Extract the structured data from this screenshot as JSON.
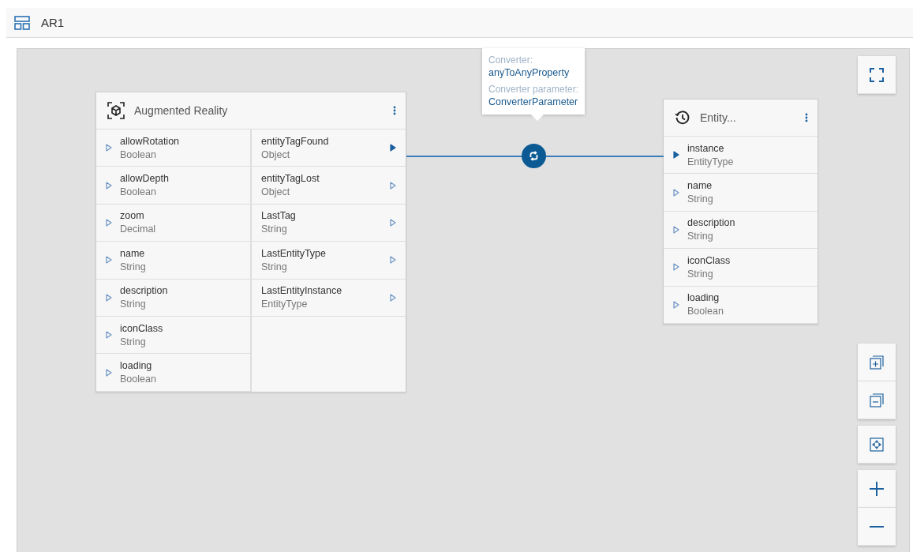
{
  "header": {
    "title": "AR1"
  },
  "nodes": [
    {
      "kind": "ar",
      "title": "Augmented Reality",
      "inputs": [
        {
          "name": "allowRotation",
          "type": "Boolean",
          "connected": false
        },
        {
          "name": "allowDepth",
          "type": "Boolean",
          "connected": false
        },
        {
          "name": "zoom",
          "type": "Decimal",
          "connected": false
        },
        {
          "name": "name",
          "type": "String",
          "connected": false
        },
        {
          "name": "description",
          "type": "String",
          "connected": false
        },
        {
          "name": "iconClass",
          "type": "String",
          "connected": false
        },
        {
          "name": "loading",
          "type": "Boolean",
          "connected": false
        }
      ],
      "outputs": [
        {
          "name": "entityTagFound",
          "type": "Object",
          "connected": true
        },
        {
          "name": "entityTagLost",
          "type": "Object",
          "connected": false
        },
        {
          "name": "LastTag",
          "type": "String",
          "connected": false
        },
        {
          "name": "LastEntityType",
          "type": "String",
          "connected": false
        },
        {
          "name": "LastEntityInstance",
          "type": "EntityType",
          "connected": false
        }
      ]
    },
    {
      "kind": "history",
      "title": "Entity...",
      "inputs": [
        {
          "name": "instance",
          "type": "EntityType",
          "connected": true
        },
        {
          "name": "name",
          "type": "String",
          "connected": false
        },
        {
          "name": "description",
          "type": "String",
          "connected": false
        },
        {
          "name": "iconClass",
          "type": "String",
          "connected": false
        },
        {
          "name": "loading",
          "type": "Boolean",
          "connected": false
        }
      ]
    }
  ],
  "connection": {
    "converter_label": "Converter:",
    "converter": "anyToAnyProperty",
    "parameter_label": "Converter parameter:",
    "parameter": "ConverterParameter"
  }
}
